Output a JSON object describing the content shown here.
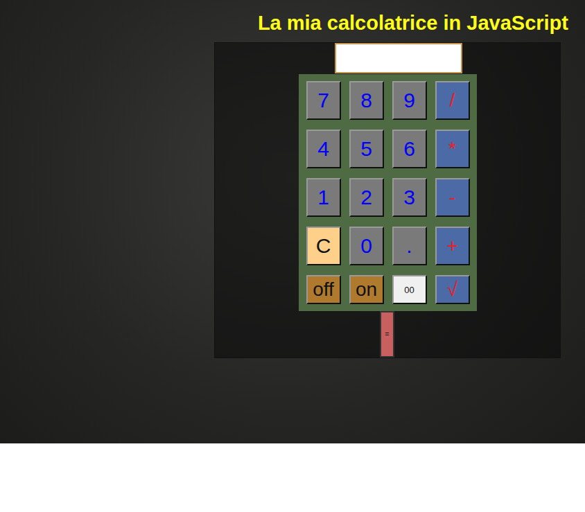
{
  "title": "La mia calcolatrice in JavaScript",
  "display": {
    "value": ""
  },
  "keys": [
    {
      "label": "7",
      "kind": "digit"
    },
    {
      "label": "8",
      "kind": "digit"
    },
    {
      "label": "9",
      "kind": "digit"
    },
    {
      "label": "/",
      "kind": "operator"
    },
    {
      "label": "4",
      "kind": "digit"
    },
    {
      "label": "5",
      "kind": "digit"
    },
    {
      "label": "6",
      "kind": "digit"
    },
    {
      "label": "*",
      "kind": "operator"
    },
    {
      "label": "1",
      "kind": "digit"
    },
    {
      "label": "2",
      "kind": "digit"
    },
    {
      "label": "3",
      "kind": "digit"
    },
    {
      "label": "-",
      "kind": "operator"
    },
    {
      "label": "C",
      "kind": "clear"
    },
    {
      "label": "0",
      "kind": "digit"
    },
    {
      "label": ".",
      "kind": "digit"
    },
    {
      "label": "+",
      "kind": "operator"
    },
    {
      "label": "off",
      "kind": "power"
    },
    {
      "label": "on",
      "kind": "power"
    },
    {
      "label": "00",
      "kind": "double"
    },
    {
      "label": "√",
      "kind": "operator"
    }
  ],
  "equals": {
    "label": "="
  }
}
